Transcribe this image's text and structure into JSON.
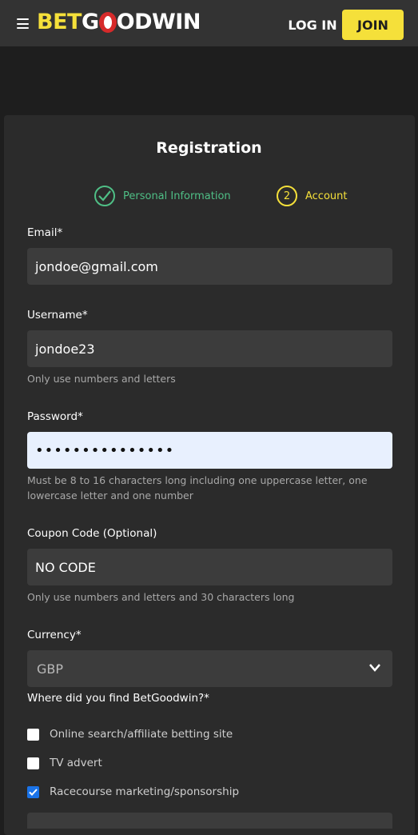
{
  "header": {
    "logo_bet": "BET",
    "logo_rest": "ODWIN",
    "logo_pre_o": "GO",
    "login_label": "LOG IN",
    "join_label": "JOIN"
  },
  "form": {
    "title": "Registration",
    "steps": [
      {
        "label": "Personal Information",
        "icon": "check-icon"
      },
      {
        "number": "2",
        "label": "Account"
      }
    ],
    "email": {
      "label": "Email*",
      "value": "jondoe@gmail.com"
    },
    "username": {
      "label": "Username*",
      "value": "jondoe23",
      "hint": "Only use numbers and letters"
    },
    "password": {
      "label": "Password*",
      "value": "•••••••••••••••",
      "hint": "Must be 8 to 16 characters long including one uppercase letter, one lowercase letter and one number"
    },
    "coupon": {
      "label": "Coupon Code (Optional)",
      "value": "NO CODE",
      "hint": "Only use numbers and letters and 30 characters long"
    },
    "currency": {
      "label": "Currency*",
      "value": "GBP"
    },
    "source": {
      "label": "Where did you find BetGoodwin?*",
      "options": [
        {
          "label": "Online search/affiliate betting site",
          "checked": false
        },
        {
          "label": "TV advert",
          "checked": false
        },
        {
          "label": "Racecourse marketing/sponsorship",
          "checked": true
        }
      ]
    }
  },
  "colors": {
    "accent_yellow": "#f5e03a",
    "success_green": "#4fbf86",
    "logo_red": "#d62a2a"
  }
}
